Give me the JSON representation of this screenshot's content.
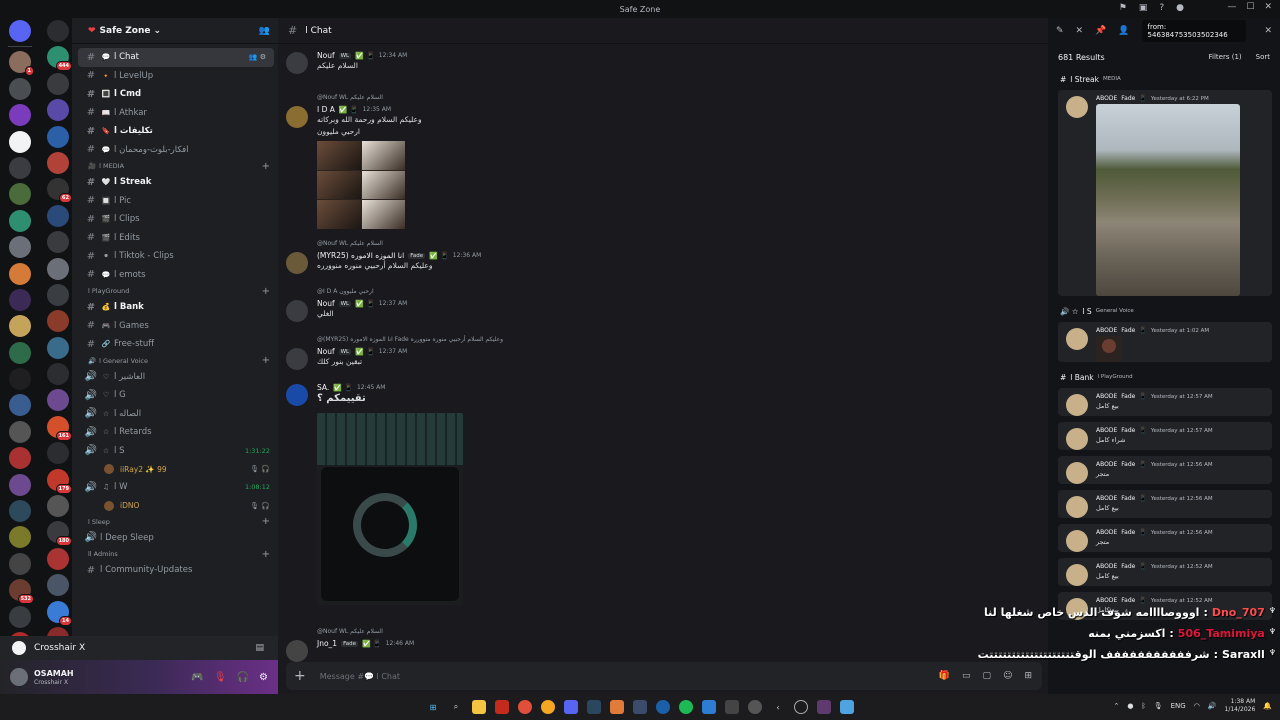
{
  "window": {
    "title": "Safe Zone"
  },
  "rail": {
    "badges_col_a": [
      "",
      "1",
      "",
      "",
      "",
      "",
      "",
      "",
      "",
      "",
      "",
      "",
      "",
      "",
      "",
      "",
      "",
      "",
      "",
      "",
      "",
      "532",
      "",
      "249",
      "NEW"
    ],
    "badges_col_b": [
      "",
      "444",
      "",
      "",
      "",
      "",
      "62",
      "",
      "",
      "",
      "",
      "",
      "",
      "",
      "",
      "161",
      "",
      "179",
      "",
      "180",
      "",
      "",
      "14",
      ""
    ]
  },
  "server": {
    "name": "Safe Zone"
  },
  "channels": [
    {
      "name": "l Chat",
      "type": "text",
      "emoji": "💬",
      "active": true
    },
    {
      "name": "l LevelUp",
      "type": "text",
      "emoji": "🔸"
    },
    {
      "name": "l Cmd",
      "type": "text",
      "emoji": "🔳",
      "unread": true
    },
    {
      "name": "l Athkar",
      "type": "text",
      "emoji": "📖"
    },
    {
      "name": "l تكليفات",
      "type": "text",
      "emoji": "🔖",
      "unread": true
    },
    {
      "name": "l افكار-بلوت-ومحمان",
      "type": "text",
      "emoji": "💬"
    }
  ],
  "category_media": "l MEDIA",
  "media_channels": [
    {
      "name": "l Streak",
      "emoji": "🤍",
      "unread": true
    },
    {
      "name": "l Pic",
      "emoji": "🔲"
    },
    {
      "name": "l Clips",
      "emoji": "🎬"
    },
    {
      "name": "l Edits",
      "emoji": "🎬"
    },
    {
      "name": "l Tiktok - Clips",
      "emoji": "⚫"
    },
    {
      "name": "l emots",
      "emoji": "💬"
    }
  ],
  "category_playground": "l PlayGround",
  "playground_channels": [
    {
      "name": "l Bank",
      "emoji": "💰",
      "unread": true
    },
    {
      "name": "l Games",
      "emoji": "🎮"
    },
    {
      "name": "Free-stuff",
      "emoji": "🔗"
    }
  ],
  "category_voice": "l General Voice",
  "voice_channels": [
    {
      "name": "l العاشير",
      "emoji": "♡"
    },
    {
      "name": "l G",
      "emoji": "♡"
    },
    {
      "name": "l الصاله",
      "emoji": "☆"
    },
    {
      "name": "l Retards",
      "emoji": "☆"
    },
    {
      "name": "l S",
      "emoji": "☆",
      "time": "1:31:22",
      "live": true
    },
    {
      "name": "l W",
      "emoji": "♫",
      "time": "1:08:12",
      "live": true
    }
  ],
  "voice_users": {
    "s": "iiRay2 ✨ 99",
    "w": "iDNO"
  },
  "category_sleep": "l Sleep",
  "sleep_channel": "l Deep Sleep",
  "category_admins": "ll Admins",
  "admins_channel": "l Community-Updates",
  "activity": {
    "name": "Crosshair X"
  },
  "user": {
    "name": "OSAMAH",
    "status": "Crosshair X"
  },
  "chat": {
    "header": "l Chat",
    "composer_placeholder": "Message #💬 l Chat",
    "messages": [
      {
        "author": "Nouf",
        "tag": "WL",
        "time": "12:34 AM",
        "text": "السلام عليكم"
      },
      {
        "reply": "@Nouf  WL  السلام عليكم",
        "author": "I D A",
        "time": "12:35 AM",
        "text": "وعليكم السلام ورحمة الله وبركاته",
        "text2": "ارحبي مليوون"
      },
      {
        "reply": "@Nouf  WL  السلام عليكم",
        "author": "(MYR25) انا الموزه الاموره",
        "tag": "Fade",
        "time": "12:36 AM",
        "text": "وعليكم السلام أرحبيي منوره منوورره"
      },
      {
        "reply": "@I D A  ارحبي مليوون",
        "author": "Nouf",
        "tag": "WL",
        "time": "12:37 AM",
        "text": "الغلي"
      },
      {
        "reply": "@(MYR25) انا الموزه الاموره  Fade  وعليكم السلام أرحبيي منوره منوورره",
        "author": "Nouf",
        "tag": "WL",
        "time": "12:37 AM",
        "text": "تبقين بنور كلك"
      },
      {
        "author": "SA.",
        "time": "12:45 AM",
        "text": "تقييمكم ؟"
      },
      {
        "reply": "@Nouf  WL  السلام عليكم",
        "author": "Jno_1",
        "tag": "Fade",
        "time": "12:46 AM",
        "text": ""
      }
    ]
  },
  "results": {
    "search_query": "from: 546384753503502346",
    "count": "681 Results",
    "filters": "Filters (1)",
    "sort": "Sort",
    "groups": [
      {
        "channel": "l Streak",
        "category": "MEDIA",
        "items": [
          {
            "author": "ABODE",
            "tag": "Fade",
            "time": "Yesterday at 6:22 PM",
            "text": ""
          }
        ]
      },
      {
        "channel": "l S",
        "category": "General Voice",
        "items": [
          {
            "author": "ABODE",
            "tag": "Fade",
            "time": "Yesterday at 1:02 AM",
            "text": ""
          }
        ]
      },
      {
        "channel": "l Bank",
        "category": "l PlayGround",
        "items": [
          {
            "author": "ABODE",
            "tag": "Fade",
            "time": "Yesterday at 12:57 AM",
            "text": "بيع كامل"
          },
          {
            "author": "ABODE",
            "tag": "Fade",
            "time": "Yesterday at 12:57 AM",
            "text": "شراء كامل"
          },
          {
            "author": "ABODE",
            "tag": "Fade",
            "time": "Yesterday at 12:56 AM",
            "text": "متجر"
          },
          {
            "author": "ABODE",
            "tag": "Fade",
            "time": "Yesterday at 12:56 AM",
            "text": "بيع كامل"
          },
          {
            "author": "ABODE",
            "tag": "Fade",
            "time": "Yesterday at 12:56 AM",
            "text": "متجر"
          },
          {
            "author": "ABODE",
            "tag": "Fade",
            "time": "Yesterday at 12:52 AM",
            "text": "بيع كامل"
          },
          {
            "author": "ABODE",
            "tag": "Fade",
            "time": "Yesterday at 12:52 AM",
            "text": "بيع كامل"
          }
        ]
      }
    ]
  },
  "overlay": [
    {
      "name": "Dno_707",
      "text": "اوووصاااامه شوف الدس خاص شغلها لنا"
    },
    {
      "name": "506_Tamimiya",
      "text": "اكسزمني بمنه"
    },
    {
      "name": "Saraxll",
      "text": "شرففففففففففف الوقتتتتتتتتتتتتتتتتتتتت"
    }
  ],
  "taskbar": {
    "lang": "ENG",
    "time": "1:38 AM",
    "date": "1/14/2026"
  }
}
